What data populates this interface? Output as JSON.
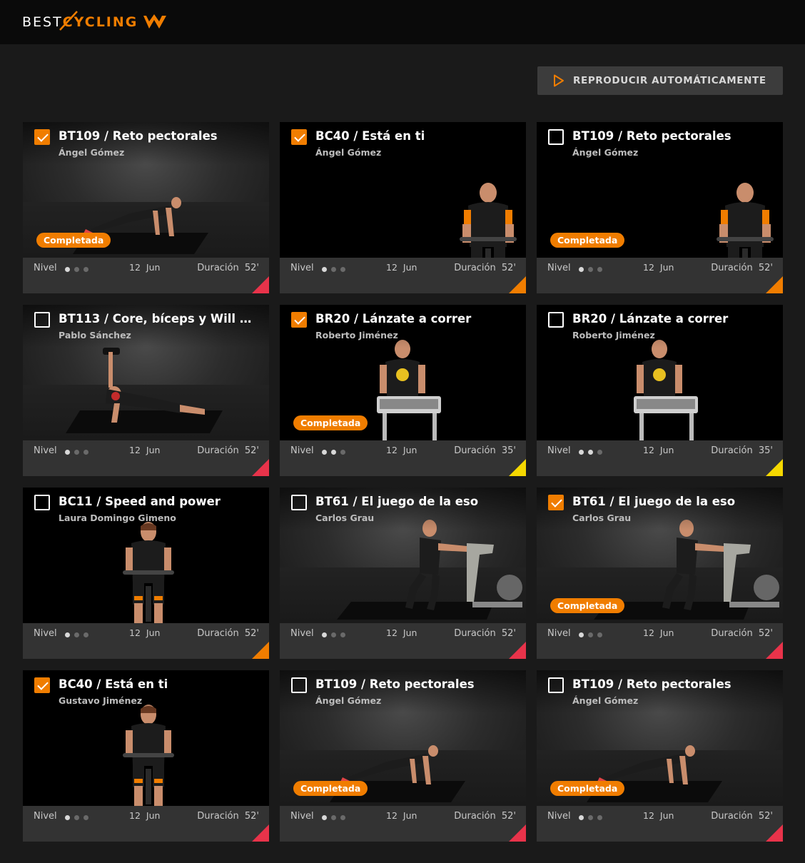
{
  "header": {
    "logo_left": "BEST",
    "logo_right": "CYCLING"
  },
  "autoplay_label": "REPRODUCIR AUTOMÁTICAMENTE",
  "labels": {
    "level": "Nivel",
    "duration": "Duración"
  },
  "colors": {
    "accent": "#f07d00",
    "completed_badge": "#f07d00",
    "corner_red": "#e8334a",
    "corner_orange": "#f07d00",
    "corner_yellow": "#f5d800"
  },
  "cards": [
    {
      "title": "BT109 / Reto pectorales",
      "coach": "Ángel Gómez",
      "checked": true,
      "completed": true,
      "completed_label": "Completada",
      "level": 1,
      "date": "12 Jun",
      "duration": "52'",
      "corner": "red",
      "scene": "pushup"
    },
    {
      "title": "BC40 / Está en ti",
      "coach": "Ángel Gómez",
      "checked": true,
      "completed": false,
      "completed_label": "",
      "level": 1,
      "date": "12 Jun",
      "duration": "52'",
      "corner": "orange",
      "scene": "bike-man"
    },
    {
      "title": "BT109 / Reto pectorales",
      "coach": "Ángel Gómez",
      "checked": false,
      "completed": true,
      "completed_label": "Completada",
      "level": 1,
      "date": "12 Jun",
      "duration": "52'",
      "corner": "orange",
      "scene": "bike-man"
    },
    {
      "title": "BT113 / Core, bíceps y Will Sm...",
      "coach": "Pablo Sánchez",
      "checked": false,
      "completed": false,
      "completed_label": "",
      "level": 1,
      "date": "12 Jun",
      "duration": "52'",
      "corner": "red",
      "scene": "sideplank"
    },
    {
      "title": "BR20 / Lánzate a correr",
      "coach": "Roberto Jiménez",
      "checked": true,
      "completed": true,
      "completed_label": "Completada",
      "level": 2,
      "date": "12 Jun",
      "duration": "35'",
      "corner": "yellow",
      "scene": "treadmill"
    },
    {
      "title": "BR20 / Lánzate a correr",
      "coach": "Roberto Jiménez",
      "checked": false,
      "completed": false,
      "completed_label": "",
      "level": 2,
      "date": "12 Jun",
      "duration": "35'",
      "corner": "yellow",
      "scene": "treadmill"
    },
    {
      "title": "BC11 / Speed and power",
      "coach": "Laura Domingo Gimeno",
      "checked": false,
      "completed": false,
      "completed_label": "",
      "level": 1,
      "date": "12 Jun",
      "duration": "52'",
      "corner": "orange",
      "scene": "bike-woman"
    },
    {
      "title": "BT61 / El juego de la eso",
      "coach": "Carlos Grau",
      "checked": false,
      "completed": false,
      "completed_label": "",
      "level": 1,
      "date": "12 Jun",
      "duration": "52'",
      "corner": "red",
      "scene": "standing-bike"
    },
    {
      "title": "BT61 / El juego de la eso",
      "coach": "Carlos Grau",
      "checked": true,
      "completed": true,
      "completed_label": "Completada",
      "level": 1,
      "date": "12 Jun",
      "duration": "52'",
      "corner": "red",
      "scene": "standing-bike"
    },
    {
      "title": "BC40 / Está en ti",
      "coach": "Gustavo Jiménez",
      "checked": true,
      "completed": false,
      "completed_label": "",
      "level": 1,
      "date": "12 Jun",
      "duration": "52'",
      "corner": "red",
      "scene": "bike-woman"
    },
    {
      "title": "BT109 / Reto pectorales",
      "coach": "Ángel Gómez",
      "checked": false,
      "completed": true,
      "completed_label": "Completada",
      "level": 1,
      "date": "12 Jun",
      "duration": "52'",
      "corner": "red",
      "scene": "pushup"
    },
    {
      "title": "BT109 / Reto pectorales",
      "coach": "Ángel Gómez",
      "checked": false,
      "completed": true,
      "completed_label": "Completada",
      "level": 1,
      "date": "12 Jun",
      "duration": "52'",
      "corner": "red",
      "scene": "pushup"
    }
  ]
}
